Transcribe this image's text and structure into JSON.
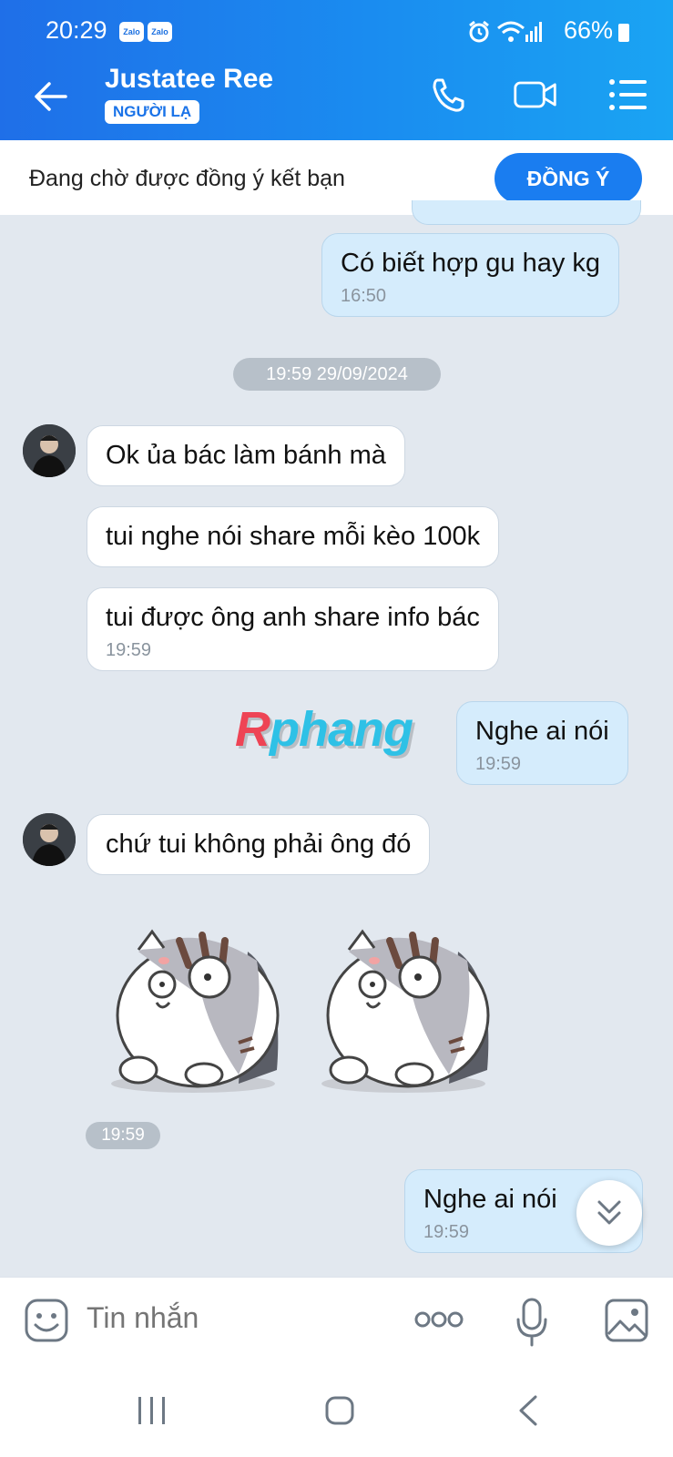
{
  "status_bar": {
    "time": "20:29",
    "notif_badge_1": "Zalo",
    "notif_badge_2": "Zalo",
    "battery": "66%"
  },
  "header": {
    "contact_name": "Justatee Ree",
    "badge": "NGƯỜI LẠ",
    "icons": [
      "back-arrow-icon",
      "phone-icon",
      "video-call-icon",
      "menu-list-icon"
    ]
  },
  "pending_bar": {
    "text": "Đang chờ được đồng ý kết bạn",
    "accept_label": "ĐỒNG Ý"
  },
  "messages": [
    {
      "side": "out",
      "text": "Có biết hợp gu hay kg",
      "time": "16:50"
    },
    {
      "side": "in",
      "text": "Ok ủa bác làm bánh mà"
    },
    {
      "side": "in",
      "text": "tui nghe nói share mỗi kèo 100k"
    },
    {
      "side": "in",
      "text": "tui được ông anh share info bác",
      "time": "19:59"
    },
    {
      "side": "out",
      "text": "Nghe ai nói",
      "time": "19:59"
    },
    {
      "side": "in",
      "text": "chứ tui không phải ông đó"
    },
    {
      "side": "out",
      "text": "Nghe ai nói",
      "time": "19:59"
    }
  ],
  "date_separator": "19:59 29/09/2024",
  "sticker_time": "19:59",
  "watermark": {
    "first": "R",
    "rest": "phang"
  },
  "composer": {
    "placeholder": "Tin nhắn",
    "icons": [
      "emoji-icon",
      "more-dots-icon",
      "microphone-icon",
      "image-icon"
    ]
  },
  "colors": {
    "header_start": "#1f6fe8",
    "header_end": "#1aa4f3",
    "outgoing_bubble": "#d5ecfc",
    "incoming_bubble": "#ffffff",
    "background": "#e2e8ef",
    "accent": "#1a7df0"
  }
}
